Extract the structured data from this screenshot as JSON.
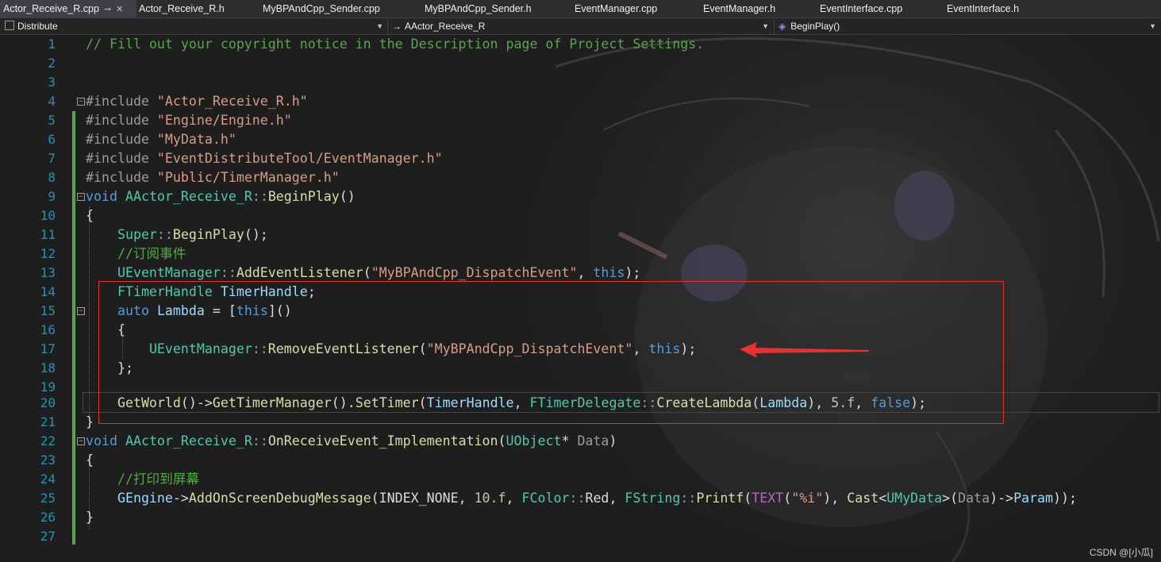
{
  "tabs": [
    {
      "label": "Actor_Receive_R.cpp",
      "active": true
    },
    {
      "label": "Actor_Receive_R.h"
    },
    {
      "label": "MyBPAndCpp_Sender.cpp"
    },
    {
      "label": "MyBPAndCpp_Sender.h"
    },
    {
      "label": "EventManager.cpp"
    },
    {
      "label": "EventManager.h"
    },
    {
      "label": "EventInterface.cpp"
    },
    {
      "label": "EventInterface.h"
    }
  ],
  "tab_icons": {
    "pin": "⊸",
    "close": "✕"
  },
  "navbar": {
    "project": "Distribute",
    "scope_arrow": "→",
    "scope": "AActor_Receive_R",
    "member": "BeginPlay()"
  },
  "code": {
    "lines": [
      {
        "n": "1",
        "t": "// Fill out your copyright notice in the Description page of Project Settings."
      },
      {
        "n": "2",
        "t": ""
      },
      {
        "n": "3",
        "t": ""
      },
      {
        "n": "4",
        "t": "#include \"Actor_Receive_R.h\""
      },
      {
        "n": "5",
        "t": "#include \"Engine/Engine.h\""
      },
      {
        "n": "6",
        "t": "#include \"MyData.h\""
      },
      {
        "n": "7",
        "t": "#include \"EventDistributeTool/EventManager.h\""
      },
      {
        "n": "8",
        "t": "#include \"Public/TimerManager.h\""
      },
      {
        "n": "9",
        "t": "void AActor_Receive_R::BeginPlay()"
      },
      {
        "n": "10",
        "t": "{"
      },
      {
        "n": "11",
        "t": "    Super::BeginPlay();"
      },
      {
        "n": "12",
        "t": "    //订阅事件"
      },
      {
        "n": "13",
        "t": "    UEventManager::AddEventListener(\"MyBPAndCpp_DispatchEvent\", this);"
      },
      {
        "n": "14",
        "t": "    FTimerHandle TimerHandle;"
      },
      {
        "n": "15",
        "t": "    auto Lambda = [this]()"
      },
      {
        "n": "16",
        "t": "    {"
      },
      {
        "n": "17",
        "t": "        UEventManager::RemoveEventListener(\"MyBPAndCpp_DispatchEvent\", this);"
      },
      {
        "n": "18",
        "t": "    };"
      },
      {
        "n": "19",
        "t": ""
      },
      {
        "n": "20",
        "t": "    GetWorld()->GetTimerManager().SetTimer(TimerHandle, FTimerDelegate::CreateLambda(Lambda), 5.f, false);"
      },
      {
        "n": "21",
        "t": "}"
      },
      {
        "n": "22",
        "t": "void AActor_Receive_R::OnReceiveEvent_Implementation(UObject* Data)"
      },
      {
        "n": "23",
        "t": "{"
      },
      {
        "n": "24",
        "t": "    //打印到屏幕"
      },
      {
        "n": "25",
        "t": "    GEngine->AddOnScreenDebugMessage(INDEX_NONE, 10.f, FColor::Red, FString::Printf(TEXT(\"%i\"), Cast<UMyData>(Data)->Param));"
      },
      {
        "n": "26",
        "t": "}"
      },
      {
        "n": "27",
        "t": ""
      }
    ]
  },
  "watermark": "CSDN @[小瓜]",
  "colors": {
    "highlight_box": "#e23333",
    "arrow": "#e23333",
    "change_bar": "#57a64a"
  }
}
